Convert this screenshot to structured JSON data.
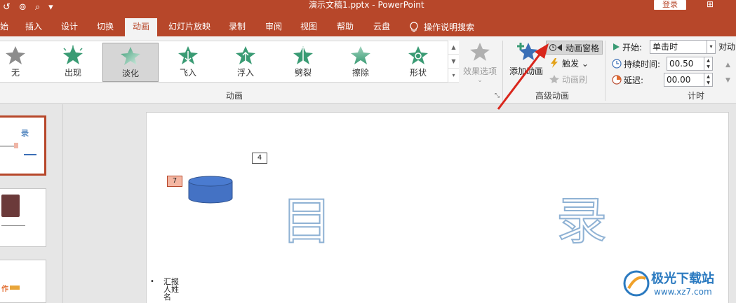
{
  "titlebar": {
    "quick_access": [
      "↺",
      "⊚",
      "⌕",
      "▾"
    ],
    "document_title": "演示文稿1.pptx  -  PowerPoint",
    "login_label": "登录",
    "restore_glyph": "⊞"
  },
  "tabs": [
    {
      "label": "始",
      "active": false
    },
    {
      "label": "插入",
      "active": false
    },
    {
      "label": "设计",
      "active": false
    },
    {
      "label": "切换",
      "active": false
    },
    {
      "label": "动画",
      "active": true
    },
    {
      "label": "幻灯片放映",
      "active": false
    },
    {
      "label": "录制",
      "active": false
    },
    {
      "label": "审阅",
      "active": false
    },
    {
      "label": "视图",
      "active": false
    },
    {
      "label": "帮助",
      "active": false
    },
    {
      "label": "云盘",
      "active": false
    }
  ],
  "tell_me": "操作说明搜索",
  "animation_gallery": {
    "items": [
      {
        "label": "无",
        "icon": "star-grey-icon"
      },
      {
        "label": "出现",
        "icon": "star-burst-icon"
      },
      {
        "label": "淡化",
        "icon": "star-fade-icon",
        "selected": true
      },
      {
        "label": "飞入",
        "icon": "star-fly-icon"
      },
      {
        "label": "浮入",
        "icon": "star-float-icon"
      },
      {
        "label": "劈裂",
        "icon": "star-split-icon"
      },
      {
        "label": "擦除",
        "icon": "star-wipe-icon"
      },
      {
        "label": "形状",
        "icon": "star-shape-icon"
      }
    ],
    "scroll": [
      "▲",
      "▼",
      "▾"
    ],
    "group_label": "动画",
    "effect_options_label": "效果选项",
    "effect_options_caret": "⌄",
    "launcher": "⤡"
  },
  "advanced_animation": {
    "add_animation_label": "添加动画",
    "animation_pane_label": "动画窗格",
    "trigger_label": "触发 ⌄",
    "painter_label": "动画刷",
    "group_label": "高级动画"
  },
  "timing": {
    "start_label": "开始:",
    "start_value": "单击时",
    "duration_label": "持续时间:",
    "duration_value": "00.50",
    "delay_label": "延迟:",
    "delay_value": "00.00",
    "group_label": "计时",
    "reorder_label": "对动",
    "combo_arrow": "▾",
    "spin_up": "▲",
    "spin_down": "▼",
    "reorder_arrows": [
      "▲",
      "▼"
    ]
  },
  "thumbnails": [
    {
      "title_glyph": "录"
    },
    {},
    {
      "title_glyph": "作"
    }
  ],
  "slide": {
    "tag_top": "4",
    "tag_left": "7",
    "char_left": "目",
    "char_right": "录",
    "bullet": "•",
    "name_text": "汇报人姓名"
  },
  "watermark": {
    "title": "极光下载站",
    "url": "www.xz7.com"
  },
  "colors": {
    "accent": "#b7472a",
    "shape_fill": "#4472c4",
    "star_green": "#3a9b74"
  }
}
